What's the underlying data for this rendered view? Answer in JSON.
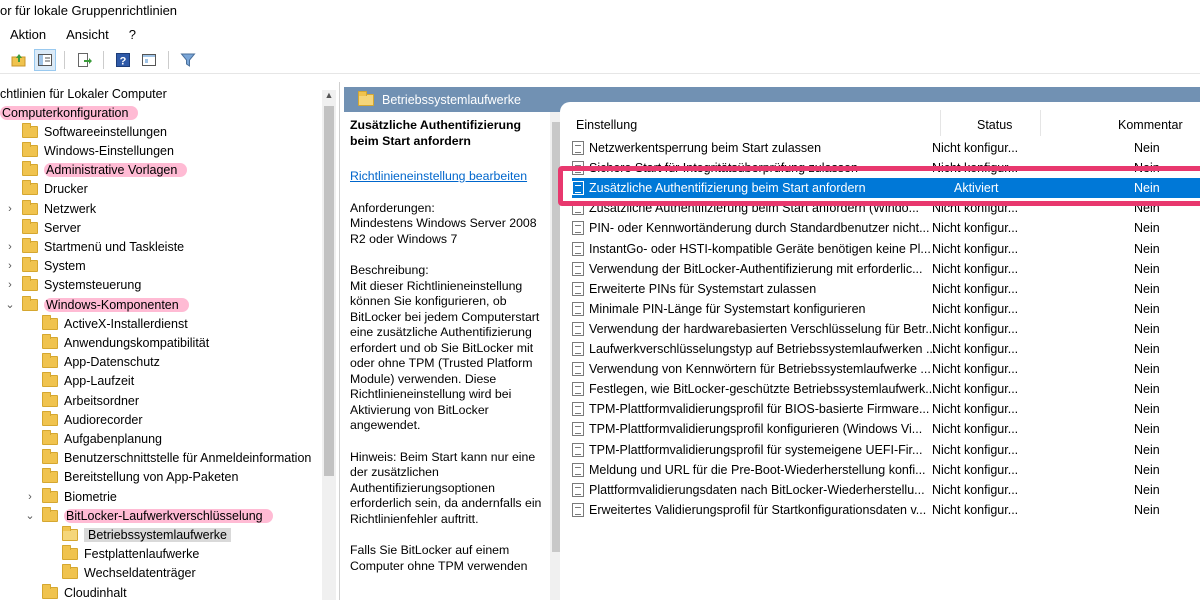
{
  "window": {
    "title": "or für lokale Gruppenrichtlinien"
  },
  "menu": [
    "Aktion",
    "Ansicht",
    "?"
  ],
  "toolbar_icons": [
    "back-icon",
    "forward-icon",
    "up-folder-icon",
    "show-hide-tree-icon",
    "export-icon",
    "help-icon",
    "properties-icon",
    "filter-icon"
  ],
  "tree": {
    "root": "chtlinien für Lokaler Computer",
    "items": [
      {
        "label": "Computerkonfiguration",
        "level": 0,
        "chevron": "",
        "folder": false,
        "highlight": true
      },
      {
        "label": "Softwareeinstellungen",
        "level": 1,
        "chevron": "",
        "folder": true
      },
      {
        "label": "Windows-Einstellungen",
        "level": 1,
        "chevron": "",
        "folder": true
      },
      {
        "label": "Administrative Vorlagen",
        "level": 1,
        "chevron": "",
        "folder": true,
        "highlight": true
      },
      {
        "label": "Drucker",
        "level": 2,
        "chevron": "",
        "folder": true
      },
      {
        "label": "Netzwerk",
        "level": 2,
        "chevron": "›",
        "folder": true
      },
      {
        "label": "Server",
        "level": 2,
        "chevron": "",
        "folder": true
      },
      {
        "label": "Startmenü und Taskleiste",
        "level": 2,
        "chevron": "›",
        "folder": true
      },
      {
        "label": "System",
        "level": 2,
        "chevron": "›",
        "folder": true
      },
      {
        "label": "Systemsteuerung",
        "level": 2,
        "chevron": "›",
        "folder": true
      },
      {
        "label": "Windows-Komponenten",
        "level": 2,
        "chevron": "⌄",
        "folder": true,
        "highlight": true
      },
      {
        "label": "ActiveX-Installerdienst",
        "level": 3,
        "chevron": "",
        "folder": true
      },
      {
        "label": "Anwendungskompatibilität",
        "level": 3,
        "chevron": "",
        "folder": true
      },
      {
        "label": "App-Datenschutz",
        "level": 3,
        "chevron": "",
        "folder": true
      },
      {
        "label": "App-Laufzeit",
        "level": 3,
        "chevron": "",
        "folder": true
      },
      {
        "label": "Arbeitsordner",
        "level": 3,
        "chevron": "",
        "folder": true
      },
      {
        "label": "Audiorecorder",
        "level": 3,
        "chevron": "",
        "folder": true
      },
      {
        "label": "Aufgabenplanung",
        "level": 3,
        "chevron": "",
        "folder": true
      },
      {
        "label": "Benutzerschnittstelle für Anmeldeinformation",
        "level": 3,
        "chevron": "",
        "folder": true
      },
      {
        "label": "Bereitstellung von App-Paketen",
        "level": 3,
        "chevron": "",
        "folder": true
      },
      {
        "label": "Biometrie",
        "level": 3,
        "chevron": "›",
        "folder": true
      },
      {
        "label": "BitLocker-Laufwerkverschlüsselung",
        "level": 3,
        "chevron": "⌄",
        "folder": true,
        "highlight": true
      },
      {
        "label": "Betriebssystemlaufwerke",
        "level": 4,
        "chevron": "",
        "folder": true,
        "selected": true
      },
      {
        "label": "Festplattenlaufwerke",
        "level": 4,
        "chevron": "",
        "folder": true
      },
      {
        "label": "Wechseldatenträger",
        "level": 4,
        "chevron": "",
        "folder": true
      },
      {
        "label": "Cloudinhalt",
        "level": 3,
        "chevron": "",
        "folder": true
      }
    ]
  },
  "right_header": "Betriebssystemlaufwerke",
  "description": {
    "title": "Zusätzliche Authentifizierung beim Start anfordern",
    "edit_link": "Richtlinieneinstellung bearbeiten",
    "requirements": "Anforderungen:\nMindestens Windows Server 2008 R2 oder Windows 7",
    "description": "Beschreibung:\nMit dieser Richtlinieneinstellung können Sie konfigurieren, ob BitLocker bei jedem Computerstart eine zusätzliche Authentifizierung erfordert und ob Sie BitLocker mit oder ohne TPM (Trusted Platform Module) verwenden. Diese Richtlinieneinstellung wird bei Aktivierung von BitLocker angewendet.",
    "note": "Hinweis: Beim Start kann nur eine der zusätzlichen Authentifizierungsoptionen erforderlich sein, da andernfalls ein Richtlinienfehler auftritt.",
    "more": "Falls Sie BitLocker auf einem Computer ohne TPM verwenden"
  },
  "columns": {
    "setting": "Einstellung",
    "status": "Status",
    "comment": "Kommentar"
  },
  "policies": [
    {
      "name": "Netzwerkentsperrung beim Start zulassen",
      "status": "Nicht konfigur...",
      "comment": "Nein"
    },
    {
      "name": "Sichere Start für Integritätsüberprüfung zulassen",
      "status": "Nicht konfigur...",
      "comment": "Nein"
    },
    {
      "name": "Zusätzliche Authentifizierung beim Start anfordern",
      "status": "Aktiviert",
      "comment": "Nein",
      "selected": true
    },
    {
      "name": "Zusätzliche Authentifizierung beim Start anfordern (Windo...",
      "status": "Nicht konfigur...",
      "comment": "Nein"
    },
    {
      "name": "PIN- oder Kennwortänderung durch Standardbenutzer nicht...",
      "status": "Nicht konfigur...",
      "comment": "Nein"
    },
    {
      "name": "InstantGo- oder HSTI-kompatible Geräte benötigen keine Pl...",
      "status": "Nicht konfigur...",
      "comment": "Nein"
    },
    {
      "name": "Verwendung der BitLocker-Authentifizierung mit erforderlic...",
      "status": "Nicht konfigur...",
      "comment": "Nein"
    },
    {
      "name": "Erweiterte PINs für Systemstart zulassen",
      "status": "Nicht konfigur...",
      "comment": "Nein"
    },
    {
      "name": "Minimale PIN-Länge für Systemstart konfigurieren",
      "status": "Nicht konfigur...",
      "comment": "Nein"
    },
    {
      "name": "Verwendung der hardwarebasierten Verschlüsselung für Betr...",
      "status": "Nicht konfigur...",
      "comment": "Nein"
    },
    {
      "name": "Laufwerkverschlüsselungstyp auf Betriebssystemlaufwerken ...",
      "status": "Nicht konfigur...",
      "comment": "Nein"
    },
    {
      "name": "Verwendung von Kennwörtern für Betriebssystemlaufwerke ...",
      "status": "Nicht konfigur...",
      "comment": "Nein"
    },
    {
      "name": "Festlegen, wie BitLocker-geschützte Betriebssystemlaufwerk...",
      "status": "Nicht konfigur...",
      "comment": "Nein"
    },
    {
      "name": "TPM-Plattformvalidierungsprofil für BIOS-basierte Firmware...",
      "status": "Nicht konfigur...",
      "comment": "Nein"
    },
    {
      "name": "TPM-Plattformvalidierungsprofil konfigurieren (Windows Vi...",
      "status": "Nicht konfigur...",
      "comment": "Nein"
    },
    {
      "name": "TPM-Plattformvalidierungsprofil für systemeigene UEFI-Fir...",
      "status": "Nicht konfigur...",
      "comment": "Nein"
    },
    {
      "name": "Meldung und URL für die Pre-Boot-Wiederherstellung konfi...",
      "status": "Nicht konfigur...",
      "comment": "Nein"
    },
    {
      "name": "Plattformvalidierungsdaten nach BitLocker-Wiederherstellu...",
      "status": "Nicht konfigur...",
      "comment": "Nein"
    },
    {
      "name": "Erweitertes Validierungsprofil für Startkonfigurationsdaten v...",
      "status": "Nicht konfigur...",
      "comment": "Nein"
    }
  ],
  "colors": {
    "selection": "#0078d7",
    "header_band": "#7191b3",
    "annotation": "#e8386e",
    "highlight": "#ff69a0"
  }
}
